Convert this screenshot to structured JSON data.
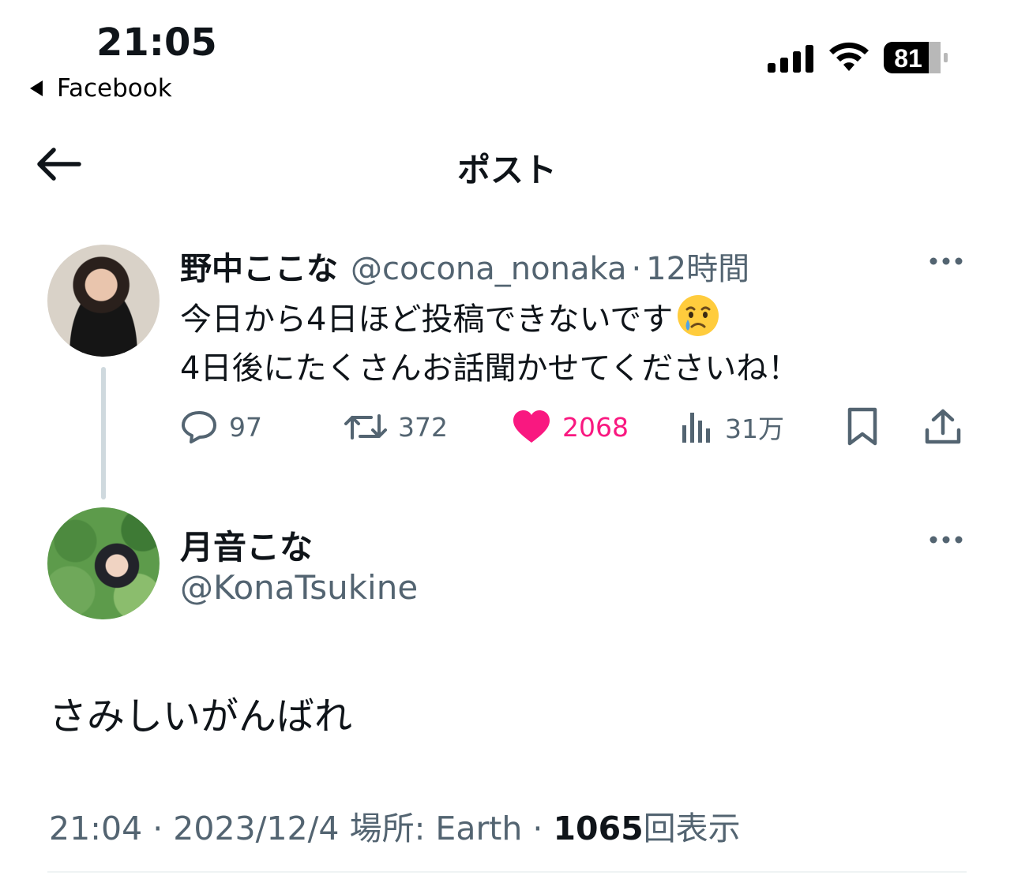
{
  "status_bar": {
    "time": "21:05",
    "back_app": "Facebook",
    "battery": "81"
  },
  "header": {
    "title": "ポスト"
  },
  "tweet1": {
    "name": "野中ここな",
    "handle": "@cocona_nonaka",
    "separator": "·",
    "time": "12時間",
    "text_line1": "今日から4日ほど投稿できないです",
    "text_line2": "4日後にたくさんお話聞かせてくださいね！",
    "emoji": "crying-face",
    "replies": "97",
    "retweets": "372",
    "likes": "2068",
    "views": "31万",
    "liked": true,
    "like_color": "#f91880"
  },
  "tweet2": {
    "name": "月音こな",
    "handle": "@KonaTsukine",
    "text": "さみしいがんばれ",
    "meta_time": "21:04",
    "meta_sep1": "·",
    "meta_date": "2023/12/4",
    "meta_location": "場所: Earth",
    "meta_sep2": "·",
    "views_count": "1065",
    "views_label": "回表示"
  },
  "colors": {
    "text_primary": "#0f1419",
    "text_secondary": "#536471",
    "thread_line": "#cfd9de"
  }
}
